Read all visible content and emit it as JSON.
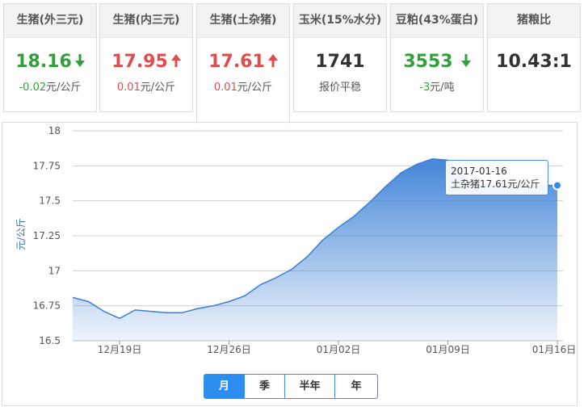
{
  "tabs": [
    {
      "title": "生猪(外三元)",
      "price": "18.16",
      "direction": "down",
      "change": "-0.02",
      "unit": "元/公斤"
    },
    {
      "title": "生猪(内三元)",
      "price": "17.95",
      "direction": "up",
      "change": "0.01",
      "unit": "元/公斤"
    },
    {
      "title": "生猪(土杂猪)",
      "price": "17.61",
      "direction": "up",
      "change": "0.01",
      "unit": "元/公斤"
    },
    {
      "title": "玉米(15%水分)",
      "price": "1741",
      "direction": "none",
      "change": "",
      "unit": "报价平稳"
    },
    {
      "title": "豆粕(43%蛋白)",
      "price": "3553",
      "direction": "down",
      "change": "-3",
      "unit": "元/吨"
    },
    {
      "title": "猪粮比",
      "price": "10.43:1",
      "direction": "none",
      "change": "",
      "unit": ""
    }
  ],
  "active_tab": 2,
  "colors": {
    "up": "#e24b4b",
    "down": "#31a03a",
    "line": "#3a7fd5",
    "accent": "#2c8ef0"
  },
  "tooltip": {
    "date": "2017-01-16",
    "label": "土杂猪",
    "value": "17.61",
    "unit": "元/公斤"
  },
  "buttons": [
    "月",
    "季",
    "半年",
    "年"
  ],
  "active_button": 0,
  "chart_data": {
    "type": "area",
    "ylabel": "元/公斤",
    "ylim": [
      16.5,
      18
    ],
    "yticks": [
      "16.5",
      "16.75",
      "17",
      "17.25",
      "17.5",
      "17.75",
      "18"
    ],
    "xticks": [
      "12月19日",
      "12月26日",
      "01月02日",
      "01月09日",
      "01月16日"
    ],
    "grid": true,
    "series": [
      {
        "x": [
          "12-16",
          "12-17",
          "12-18",
          "12-19",
          "12-20",
          "12-21",
          "12-22",
          "12-23",
          "12-24",
          "12-25",
          "12-26",
          "12-27",
          "12-28",
          "12-29",
          "12-30",
          "12-31",
          "01-01",
          "01-02",
          "01-03",
          "01-04",
          "01-05",
          "01-06",
          "01-07",
          "01-08",
          "01-09",
          "01-10",
          "01-11",
          "01-12",
          "01-13",
          "01-14",
          "01-15",
          "01-16"
        ],
        "values": [
          16.81,
          16.78,
          16.71,
          16.66,
          16.72,
          16.71,
          16.7,
          16.7,
          16.73,
          16.75,
          16.78,
          16.82,
          16.9,
          16.95,
          17.01,
          17.1,
          17.22,
          17.31,
          17.39,
          17.49,
          17.6,
          17.7,
          17.76,
          17.8,
          17.79,
          17.68,
          17.62,
          17.61,
          17.61,
          17.61,
          17.61,
          17.61
        ]
      }
    ]
  }
}
